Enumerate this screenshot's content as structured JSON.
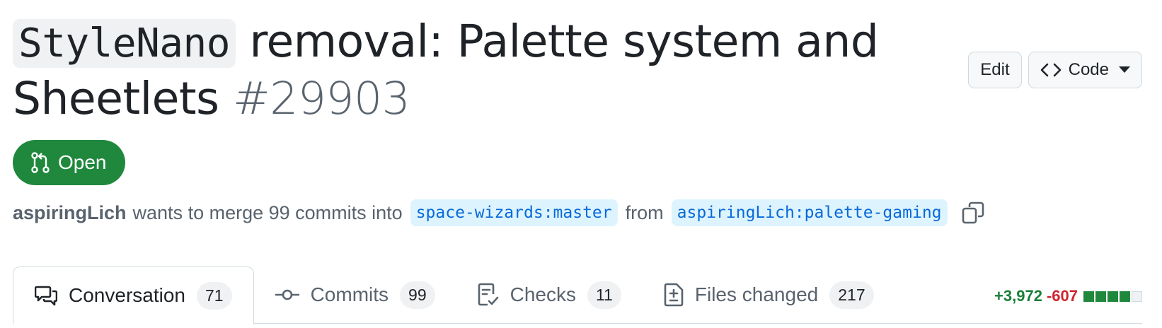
{
  "pr": {
    "title_code": "StyleNano",
    "title_text": " removal: Palette system and Sheetlets ",
    "number": "#29903",
    "state": "Open",
    "author": "aspiringLich",
    "merge_text": "wants to merge 99 commits into",
    "base_branch": "space-wizards:master",
    "from_text": "from",
    "head_branch": "aspiringLich:palette-gaming"
  },
  "actions": {
    "edit_label": "Edit",
    "code_label": "Code"
  },
  "tabs": [
    {
      "label": "Conversation",
      "count": "71",
      "icon": "comment-discussion-icon"
    },
    {
      "label": "Commits",
      "count": "99",
      "icon": "git-commit-icon"
    },
    {
      "label": "Checks",
      "count": "11",
      "icon": "checklist-icon"
    },
    {
      "label": "Files changed",
      "count": "217",
      "icon": "file-diff-icon"
    }
  ],
  "diffstat": {
    "additions": "+3,972",
    "deletions": "-607",
    "blocks_green": 4,
    "blocks_neutral": 1
  },
  "colors": {
    "open_green": "#1f883d",
    "link_blue": "#0969da",
    "add_green": "#1a7f37",
    "del_red": "#d1242f"
  }
}
